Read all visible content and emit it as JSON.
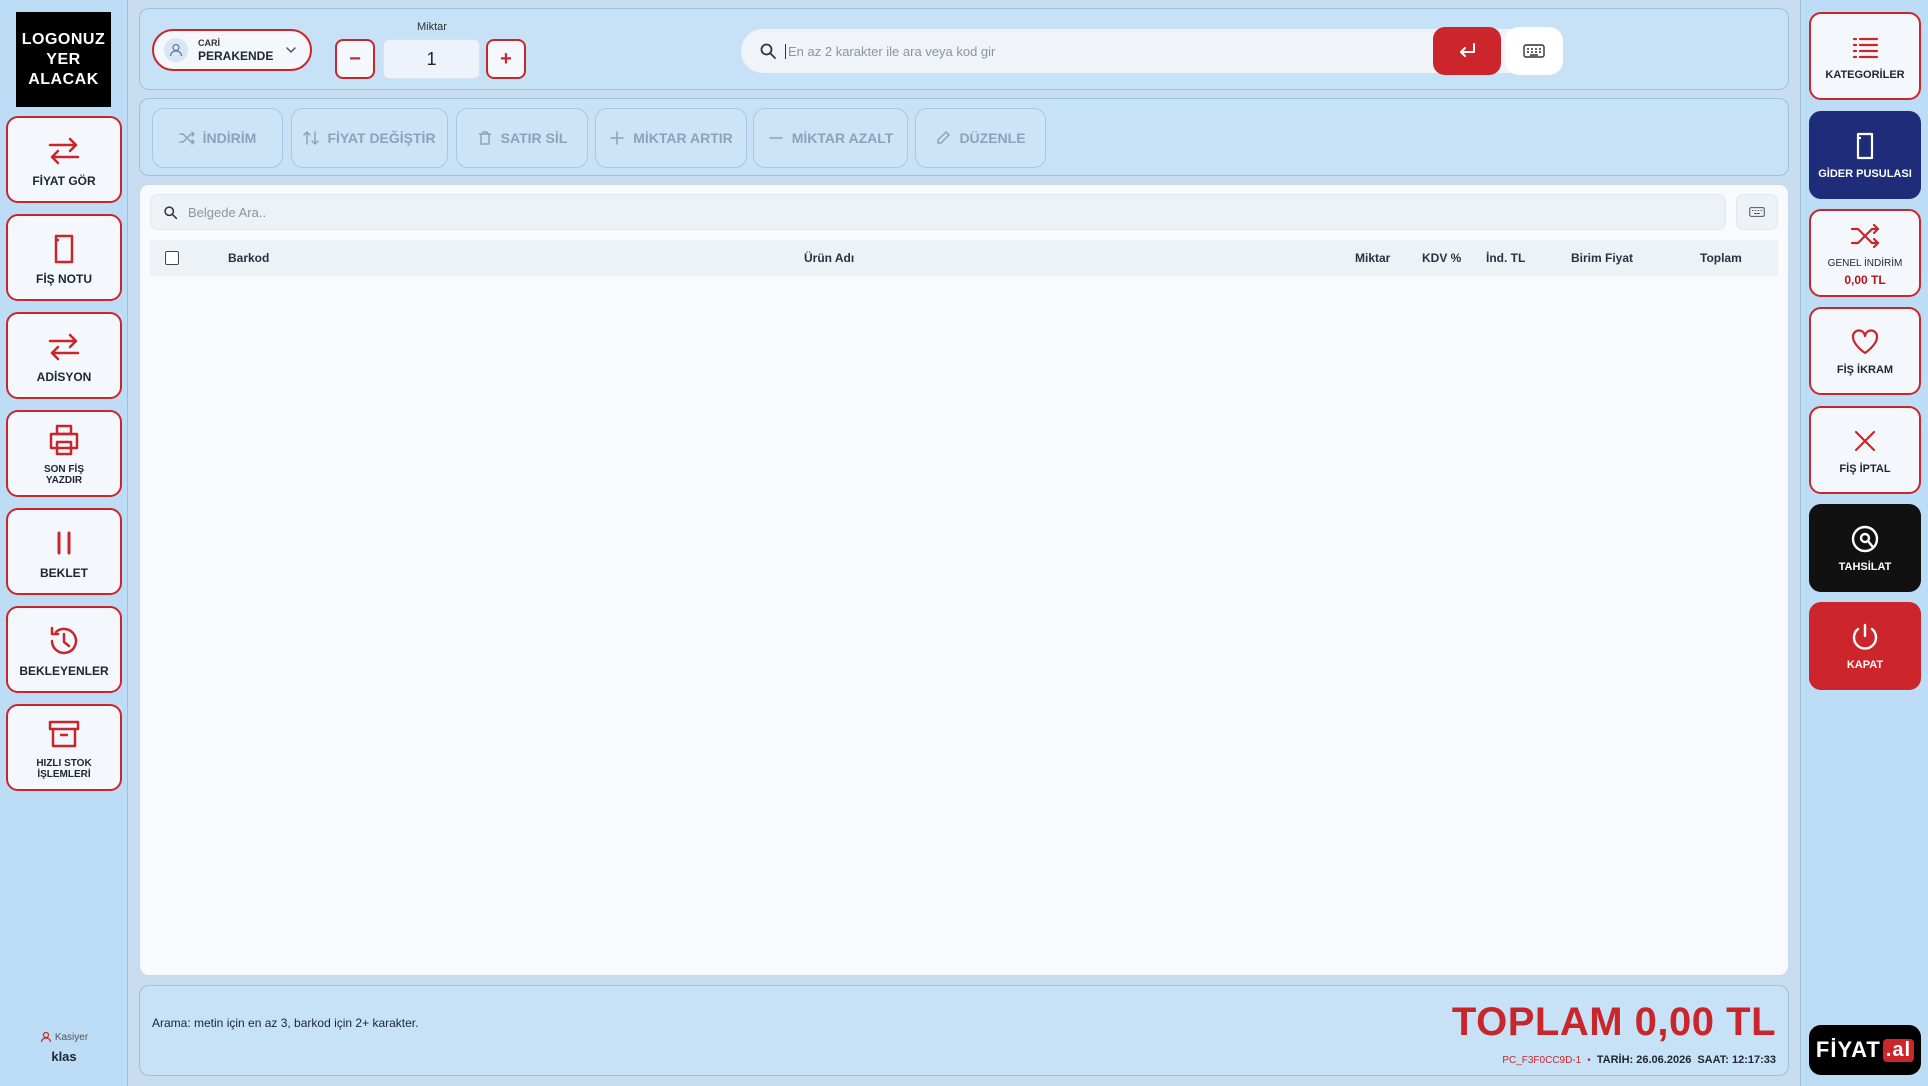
{
  "logo": {
    "text": "LOGONUZ\nYER\nALACAK"
  },
  "left_menu": [
    {
      "label": "FİYAT GÖR",
      "icon": "swap-arrows-icon"
    },
    {
      "label": "FİŞ NOTU",
      "icon": "note-icon"
    },
    {
      "label": "ADİSYON",
      "icon": "swap-arrows-icon"
    },
    {
      "label": "SON FİŞ\nYAZDIR",
      "icon": "printer-icon"
    },
    {
      "label": "BEKLET",
      "icon": "pause-icon"
    },
    {
      "label": "BEKLEYENLER",
      "icon": "history-icon"
    },
    {
      "label": "HIZLI STOK\nİŞLEMLERİ",
      "icon": "archive-box-icon"
    }
  ],
  "cashier": {
    "role": "Kasiyer",
    "name": "klas"
  },
  "top": {
    "cari_label": "CARİ",
    "cari_value": "PERAKENDE",
    "quantity_label": "Miktar",
    "quantity_value": "1",
    "minus": "−",
    "plus": "+",
    "search_placeholder": "En az 2 karakter ile ara veya kod gir"
  },
  "actions": [
    {
      "label": "İNDİRİM",
      "icon": "shuffle-icon"
    },
    {
      "label": "FİYAT DEĞİŞTİR",
      "icon": "sort-arrows-icon"
    },
    {
      "label": "SATIR SİL",
      "icon": "trash-icon"
    },
    {
      "label": "MİKTAR ARTIR",
      "icon": "plus-icon"
    },
    {
      "label": "MİKTAR AZALT",
      "icon": "minus-icon"
    },
    {
      "label": "DÜZENLE",
      "icon": "pencil-icon"
    }
  ],
  "document": {
    "search_placeholder": "Belgede Ara..",
    "columns": [
      "Barkod",
      "Ürün Adı",
      "Miktar",
      "KDV %",
      "İnd. TL",
      "Birim Fiyat",
      "Toplam"
    ],
    "rows": []
  },
  "right_menu": {
    "categories": "KATEGORİLER",
    "expense": "GİDER PUSULASI",
    "general_discount": "GENEL İNDİRİM",
    "general_discount_value": "0,00 TL",
    "treat": "FİŞ İKRAM",
    "cancel": "FİŞ İPTAL",
    "collect": "TAHSİLAT",
    "close": "KAPAT"
  },
  "brand": {
    "text": "FİYAT",
    "suffix": ".al"
  },
  "footer": {
    "hint": "Arama: metin için en az 3, barkod için 2+ karakter.",
    "total": "TOPLAM 0,00 TL",
    "pc": "PC_F3F0CC9D-1",
    "separator": "•",
    "date": "TARİH: 26.06.2026",
    "time": "SAAT: 12:17:33"
  },
  "colors": {
    "accent": "#cc252b",
    "navy": "#1f2c7a",
    "bg": "#c7e1f7"
  }
}
